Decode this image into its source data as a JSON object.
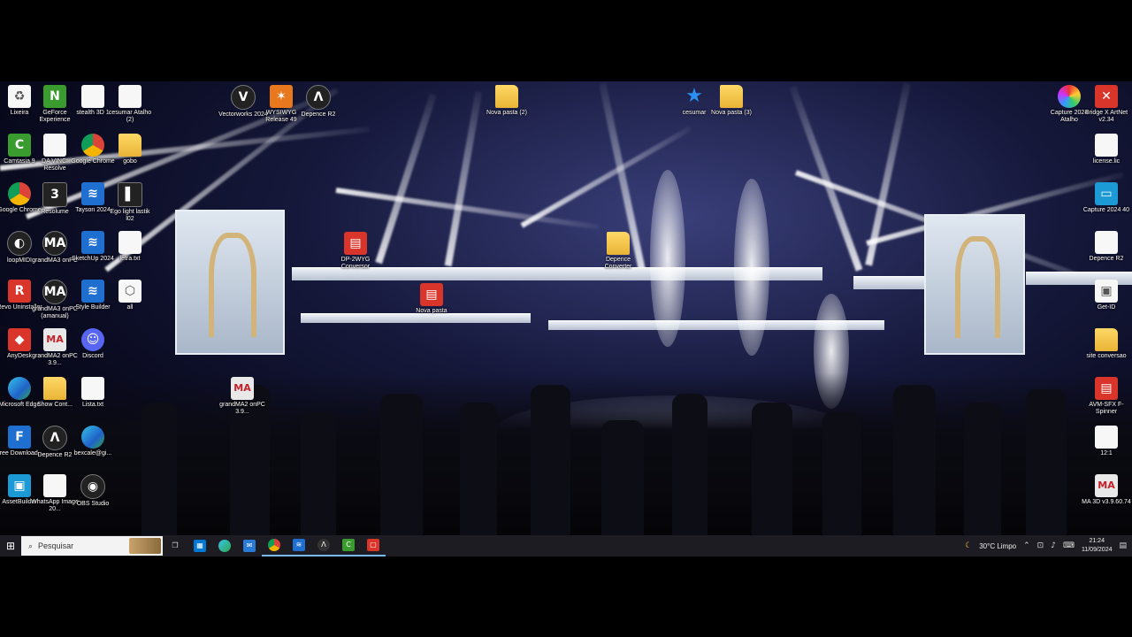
{
  "desktop_icons": {
    "col1": [
      "Lixeira",
      "GeForce Experience",
      "Camtasia 9",
      "Google Chrome",
      "loopMIDI",
      "Revo Uninstaller",
      "AnyDesk",
      "Microsoft Edge",
      "Free Download...",
      "AssetBuilder"
    ],
    "col2": [
      "stealth 3D 1",
      "DA VINCI Resolve",
      "Resolume",
      "grandMA3 onPC",
      "grandMA3 onPC (amanual)",
      "grandMA2 onPC 3.9...",
      "Discord",
      "Show Cont...",
      "Depence R2",
      "WhatsApp Image 20..."
    ],
    "col3": [
      "cesumar Atalho (2)",
      "Google Chrome",
      "Tayson 2024",
      "SketchUp 2024",
      "Style Builder",
      "Discord",
      "Lista.txt",
      "bexcale@gi...",
      "OBS Studio"
    ],
    "col4": [
      "gobo",
      "Ego light lastik l02",
      "letra.txt",
      "all"
    ],
    "top_center": [
      "Vectorworks 2024",
      "WYSIWYG Release 49",
      "Depence R2"
    ],
    "mid_center": [
      "DP-2WYG Conversor",
      "Nova pasta",
      "Depence Converter",
      "grandMA2 onPC 3.9..."
    ],
    "top_folders": [
      "Nova pasta (2)",
      "cesumar",
      "Nova pasta (3)"
    ],
    "right": [
      "Capture 2024 Atalho",
      "Bridge X ArtNet v2.34",
      "license.lic",
      "Capture 2024 40",
      "Depence R2",
      "Get-ID",
      "site conversao",
      "AVM-SFX F-Spinner",
      "12:1",
      "MA 3D v3.9.60.74"
    ]
  },
  "taskbar": {
    "search_placeholder": "Pesquisar",
    "weather": "30°C  Limpo",
    "time": "21:24",
    "date": "11/09/2024"
  },
  "colors": {
    "taskbar_bg": "#1c1c22",
    "accent": "#76b9ed"
  }
}
